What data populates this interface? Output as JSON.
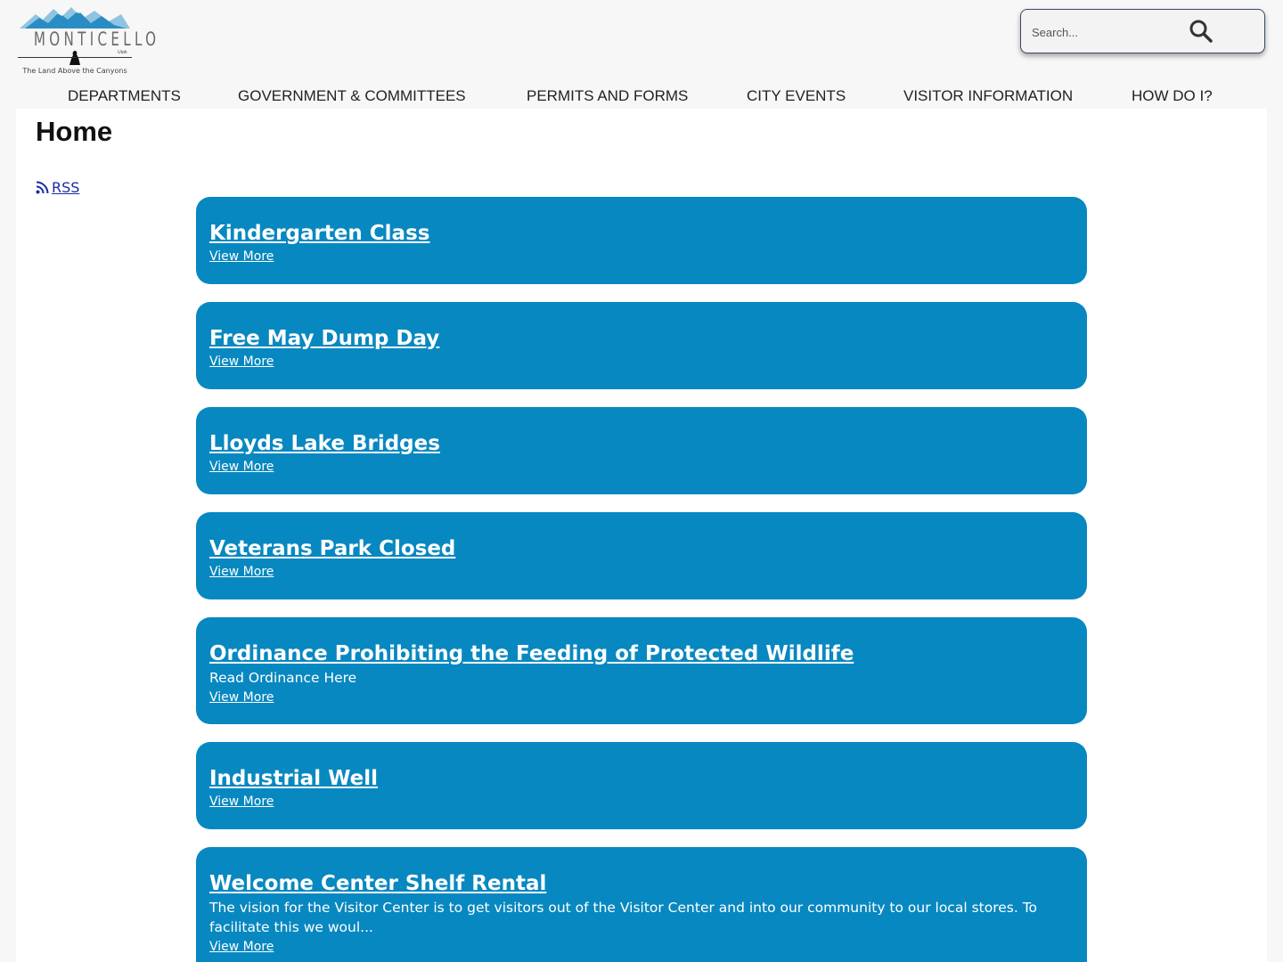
{
  "logo": {
    "name": "MONTICELLO",
    "state": "Utah",
    "tagline": "The Land Above the Canyons"
  },
  "search": {
    "placeholder": "Search..."
  },
  "nav": [
    {
      "label": "DEPARTMENTS"
    },
    {
      "label": "GOVERNMENT & COMMITTEES"
    },
    {
      "label": "PERMITS AND FORMS"
    },
    {
      "label": "CITY EVENTS"
    },
    {
      "label": "VISITOR INFORMATION"
    },
    {
      "label": "HOW DO I?"
    }
  ],
  "page": {
    "title": "Home",
    "rss_label": "RSS"
  },
  "colors": {
    "card_bg": "#0888c0",
    "link": "#1a2aa8"
  },
  "news": [
    {
      "title": "Kindergarten Class",
      "desc": "",
      "more": "View More"
    },
    {
      "title": "Free May Dump Day",
      "desc": "",
      "more": "View More"
    },
    {
      "title": "Lloyds Lake Bridges",
      "desc": "",
      "more": "View More"
    },
    {
      "title": "Veterans Park Closed",
      "desc": "",
      "more": "View More"
    },
    {
      "title": "Ordinance Prohibiting the Feeding of Protected Wildlife",
      "desc": "Read Ordinance Here",
      "more": "View More"
    },
    {
      "title": "Industrial Well",
      "desc": "",
      "more": "View More"
    },
    {
      "title": "Welcome Center Shelf Rental",
      "desc": "The vision for the Visitor Center is to get visitors out of the Visitor Center and into our community to our local stores. To facilitate this we woul...",
      "more": "View More"
    }
  ]
}
